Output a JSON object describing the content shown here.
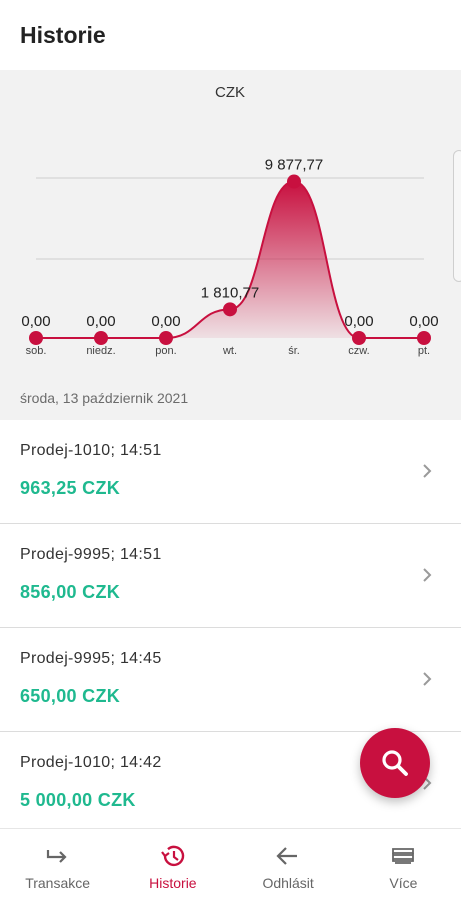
{
  "header": {
    "title": "Historie"
  },
  "chart_data": {
    "type": "area",
    "title": "CZK",
    "categories": [
      "sob.",
      "niedz.",
      "pon.",
      "wt.",
      "śr.",
      "czw.",
      "pt."
    ],
    "values": [
      0,
      0,
      0,
      1810.77,
      9877.77,
      0,
      0
    ],
    "data_labels": [
      "0,00",
      "0,00",
      "0,00",
      "1 810,77",
      "9 877,77",
      "0,00",
      "0,00"
    ],
    "ylim": [
      0,
      12500
    ],
    "grid": true,
    "accent_color": "#c8103f"
  },
  "chart_footer": {
    "date": "środa, 13 październik 2021"
  },
  "transactions": [
    {
      "name": "Prodej-1010",
      "sep": ";",
      "time": "14:51",
      "amount": "963,25 CZK"
    },
    {
      "name": "Prodej-9995",
      "sep": ";",
      "time": "14:51",
      "amount": "856,00 CZK"
    },
    {
      "name": "Prodej-9995",
      "sep": ";",
      "time": "14:45",
      "amount": "650,00 CZK"
    },
    {
      "name": "Prodej-1010",
      "sep": ";",
      "time": "14:42",
      "amount": "5 000,00 CZK"
    }
  ],
  "fab": {
    "icon": "search-icon",
    "color": "#c8103f"
  },
  "nav": [
    {
      "label": "Transakce",
      "icon": "transfer-arrow-icon"
    },
    {
      "label": "Historie",
      "icon": "history-icon",
      "active": true
    },
    {
      "label": "Odhlásit",
      "icon": "back-arrow-icon"
    },
    {
      "label": "Více",
      "icon": "layers-icon"
    }
  ],
  "colors": {
    "amount": "#1fb98f",
    "accent": "#c8103f"
  }
}
